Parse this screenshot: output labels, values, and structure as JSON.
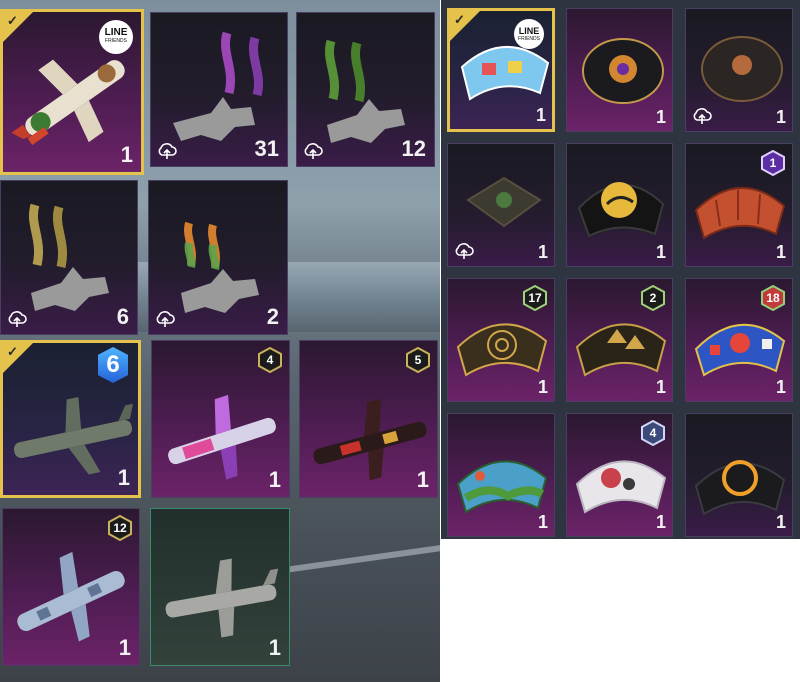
{
  "colors": {
    "selected_border": "#e5c24b",
    "tile_purple": "#4a1f55",
    "count_text": "#f2f2f2"
  },
  "left_panel": {
    "items": [
      {
        "name": "line-friends-plane-skin",
        "count": "1",
        "selected": true,
        "badge_line1": "LINE",
        "badge_line2": "FRIENDS"
      },
      {
        "name": "purple-smoke-trail",
        "count": "31",
        "cloud": true
      },
      {
        "name": "green-smoke-trail",
        "count": "12",
        "cloud": true
      },
      {
        "name": "yellow-smoke-trail",
        "count": "6",
        "cloud": true
      },
      {
        "name": "tricolor-smoke-trail",
        "count": "2",
        "cloud": true
      },
      {
        "name": "grey-cargo-plane",
        "count": "1",
        "selected": true,
        "level": "6"
      },
      {
        "name": "purple-graffiti-plane",
        "count": "1",
        "level": "4"
      },
      {
        "name": "black-red-plane",
        "count": "1",
        "level": "5"
      },
      {
        "name": "blue-camo-plane",
        "count": "1",
        "level": "12"
      },
      {
        "name": "classic-cargo-plane",
        "count": "1"
      }
    ]
  },
  "right_panel": {
    "items": [
      {
        "name": "line-friends-parachute",
        "count": "1",
        "selected": true,
        "badge_line1": "LINE",
        "badge_line2": "FRIENDS"
      },
      {
        "name": "ornate-black-parachute",
        "count": "1"
      },
      {
        "name": "dark-ornate-parachute",
        "count": "1",
        "cloud": true
      },
      {
        "name": "camo-pack-parachute",
        "count": "1",
        "cloud": true
      },
      {
        "name": "moon-night-parachute",
        "count": "1"
      },
      {
        "name": "red-stitched-parachute",
        "count": "1",
        "level": "1"
      },
      {
        "name": "gold-web-parachute",
        "count": "1",
        "level": "17"
      },
      {
        "name": "gold-triangle-parachute",
        "count": "1",
        "level": "2"
      },
      {
        "name": "blue-red-chess-parachute",
        "count": "1",
        "level": "18"
      },
      {
        "name": "jungle-parachute",
        "count": "1"
      },
      {
        "name": "white-graffiti-parachute",
        "count": "1",
        "level": "4"
      },
      {
        "name": "gold-ring-parachute",
        "count": "1"
      }
    ]
  }
}
